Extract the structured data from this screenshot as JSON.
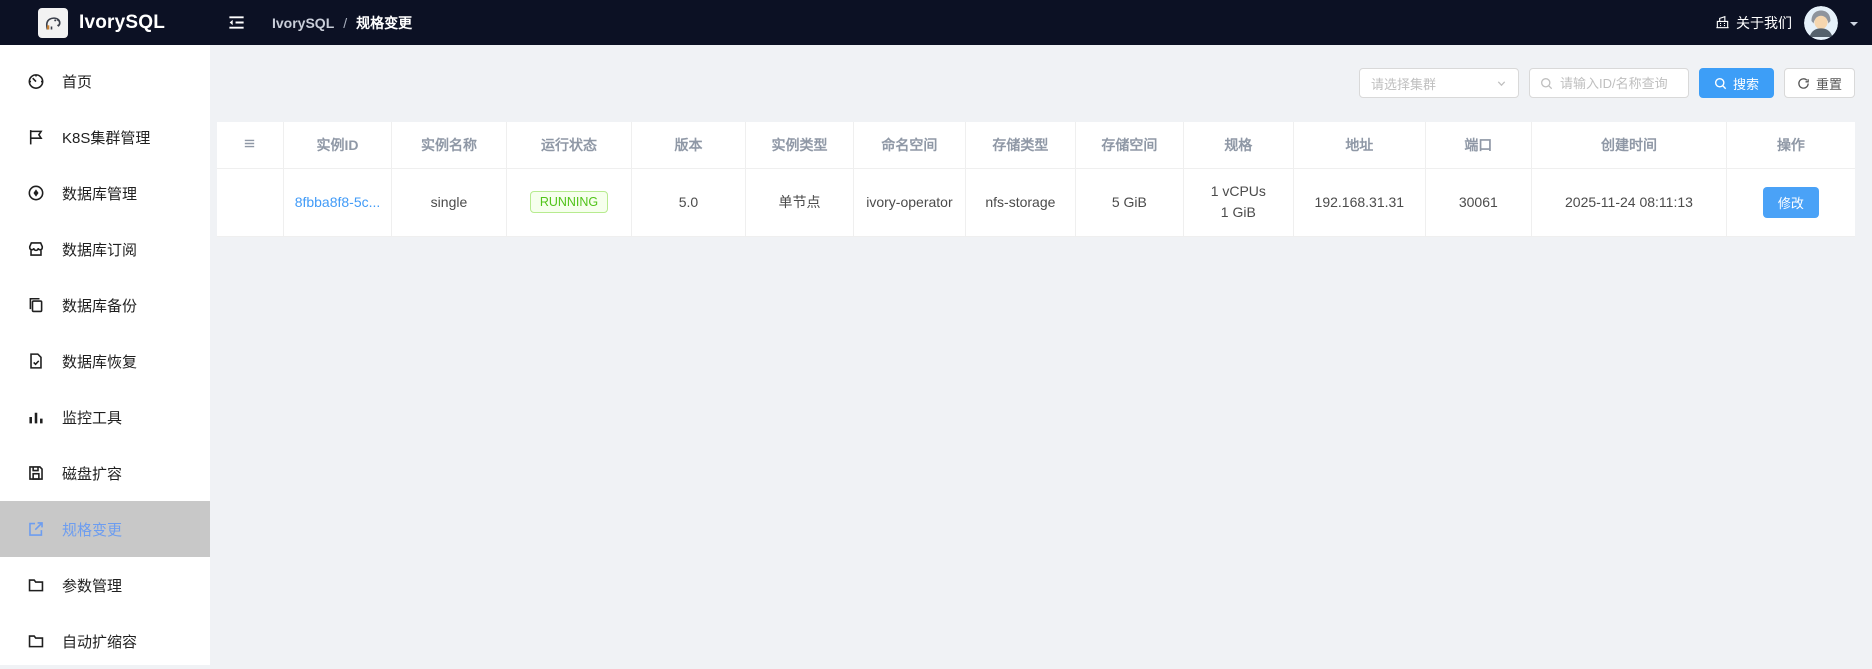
{
  "topbar": {
    "brand": "IvorySQL",
    "breadcrumb": {
      "root": "IvorySQL",
      "separator": "/",
      "current": "规格变更"
    },
    "about_label": "关于我们"
  },
  "sidebar": {
    "items": [
      {
        "label": "首页",
        "icon": "dashboard-icon",
        "active": false
      },
      {
        "label": "K8S集群管理",
        "icon": "flag-icon",
        "active": false
      },
      {
        "label": "数据库管理",
        "icon": "compass-icon",
        "active": false
      },
      {
        "label": "数据库订阅",
        "icon": "shop-icon",
        "active": false
      },
      {
        "label": "数据库备份",
        "icon": "copy-icon",
        "active": false
      },
      {
        "label": "数据库恢复",
        "icon": "file-check-icon",
        "active": false
      },
      {
        "label": "监控工具",
        "icon": "bar-chart-icon",
        "active": false
      },
      {
        "label": "磁盘扩容",
        "icon": "disk-icon",
        "active": false
      },
      {
        "label": "规格变更",
        "icon": "external-link-icon",
        "active": true
      },
      {
        "label": "参数管理",
        "icon": "folder-icon",
        "active": false
      },
      {
        "label": "自动扩缩容",
        "icon": "folder-icon",
        "active": false
      }
    ]
  },
  "filters": {
    "cluster_select_placeholder": "请选择集群",
    "search_input_placeholder": "请输入ID/名称查询",
    "search_button_label": "搜索",
    "reset_button_label": "重置"
  },
  "table": {
    "headers": [
      "实例ID",
      "实例名称",
      "运行状态",
      "版本",
      "实例类型",
      "命名空间",
      "存储类型",
      "存储空间",
      "规格",
      "地址",
      "端口",
      "创建时间",
      "操作"
    ],
    "rows": [
      {
        "instance_id": "8fbba8f8-5c...",
        "instance_name": "single",
        "status": "RUNNING",
        "version": "5.0",
        "instance_type": "单节点",
        "namespace": "ivory-operator",
        "storage_type": "nfs-storage",
        "storage_size": "5 GiB",
        "spec": [
          "1 vCPUs",
          "1 GiB"
        ],
        "address": "192.168.31.31",
        "port": "30061",
        "created_at": "2025-11-24 08:11:13",
        "action_label": "修改"
      }
    ]
  },
  "colors": {
    "topbar_bg": "#0c1124",
    "accent_blue": "#3d9ef7",
    "active_item_bg": "#c8c8c8",
    "active_item_text": "#6d9df0",
    "status_green": "#52c41a",
    "status_green_bg": "#f6ffed",
    "status_green_border": "#b7eb8f",
    "link_blue": "#429bf7"
  }
}
